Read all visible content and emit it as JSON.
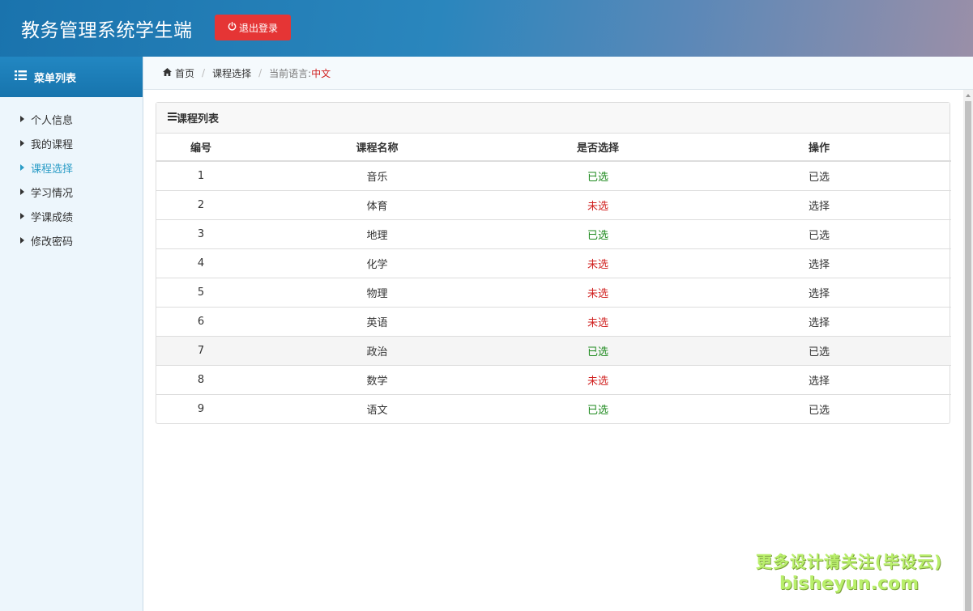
{
  "header": {
    "title": "教务管理系统学生端",
    "logout_label": "退出登录",
    "logout_icon": "power-icon"
  },
  "sidebar": {
    "title": "菜单列表",
    "title_icon": "list-icon",
    "items": [
      {
        "label": "个人信息"
      },
      {
        "label": "我的课程"
      },
      {
        "label": "课程选择"
      },
      {
        "label": "学习情况"
      },
      {
        "label": "学课成绩"
      },
      {
        "label": "修改密码"
      }
    ],
    "active_index": 2
  },
  "breadcrumb": {
    "home": "首页",
    "page": "课程选择",
    "language_label": "当前语言:",
    "language_value": "中文"
  },
  "panel": {
    "title": "课程列表",
    "title_icon": "menu-icon",
    "columns": [
      "编号",
      "课程名称",
      "是否选择",
      "操作"
    ],
    "rows": [
      {
        "id": "1",
        "name": "音乐",
        "status": "已选",
        "selected": true,
        "action": "已选"
      },
      {
        "id": "2",
        "name": "体育",
        "status": "未选",
        "selected": false,
        "action": "选择"
      },
      {
        "id": "3",
        "name": "地理",
        "status": "已选",
        "selected": true,
        "action": "已选"
      },
      {
        "id": "4",
        "name": "化学",
        "status": "未选",
        "selected": false,
        "action": "选择"
      },
      {
        "id": "5",
        "name": "物理",
        "status": "未选",
        "selected": false,
        "action": "选择"
      },
      {
        "id": "6",
        "name": "英语",
        "status": "未选",
        "selected": false,
        "action": "选择"
      },
      {
        "id": "7",
        "name": "政治",
        "status": "已选",
        "selected": true,
        "action": "已选"
      },
      {
        "id": "8",
        "name": "数学",
        "status": "未选",
        "selected": false,
        "action": "选择"
      },
      {
        "id": "9",
        "name": "语文",
        "status": "已选",
        "selected": true,
        "action": "已选"
      }
    ]
  },
  "watermark": {
    "line1": "更多设计请关注(毕设云)",
    "line2": "bisheyun.com"
  },
  "colors": {
    "header_gradient_start": "#1a73ad",
    "header_gradient_end": "#9a8fa8",
    "logout_red": "#e53535",
    "active_menu": "#2a9cc6",
    "selected_green": "#1e8a1e",
    "unselected_red": "#d0201f"
  }
}
